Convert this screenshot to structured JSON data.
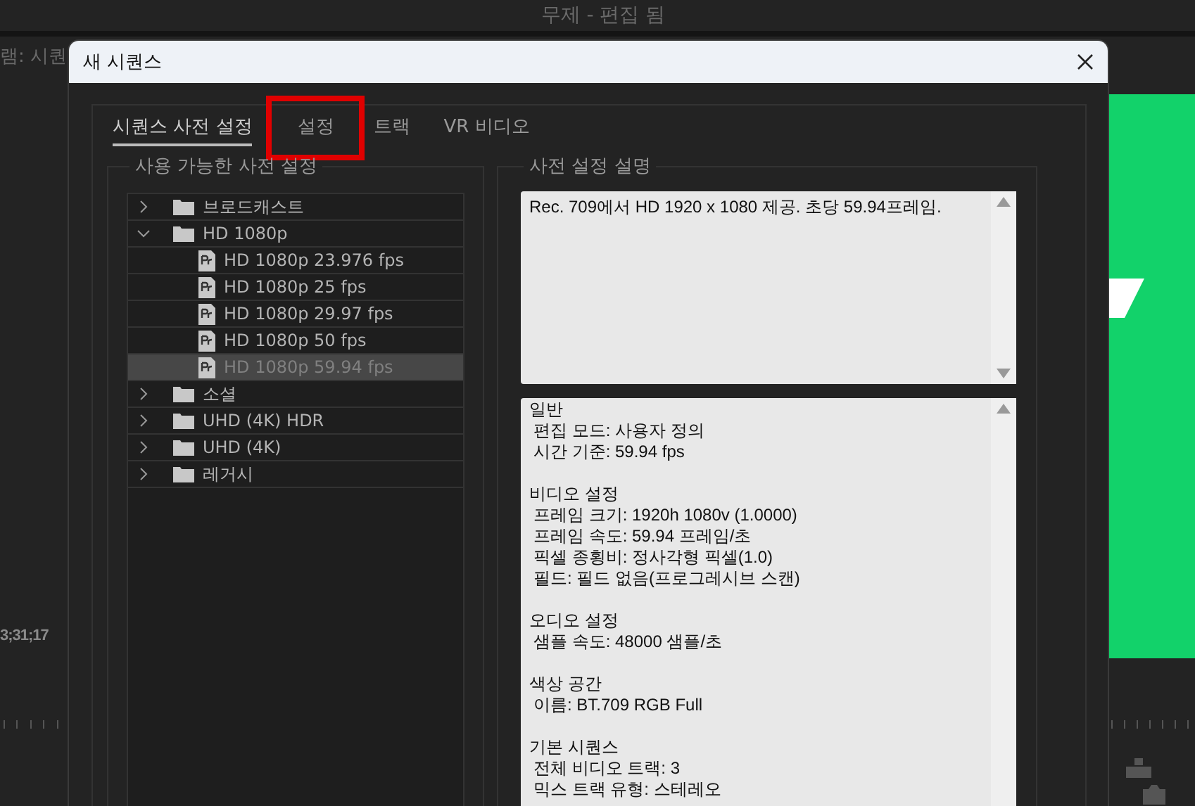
{
  "app": {
    "title": "무제 - 편집 됨",
    "left_panel_label": "램: 시퀀",
    "timecode": "3;31;17"
  },
  "dialog": {
    "title": "새 시퀀스",
    "tabs": [
      {
        "label": "시퀀스 사전 설정",
        "selected": true,
        "highlighted": false
      },
      {
        "label": "설정",
        "selected": false,
        "highlighted": true
      },
      {
        "label": "트랙",
        "selected": false,
        "highlighted": false
      },
      {
        "label": "VR 비디오",
        "selected": false,
        "highlighted": false
      }
    ],
    "presets": {
      "title": "사용 가능한 사전 설정",
      "items": [
        {
          "label": "브로드캐스트",
          "expanded": false,
          "selected": false
        },
        {
          "label": "HD 1080p",
          "expanded": true,
          "selected": false,
          "children": [
            {
              "label": "HD 1080p 23.976 fps",
              "selected": false
            },
            {
              "label": "HD 1080p 25 fps",
              "selected": false
            },
            {
              "label": "HD 1080p 29.97 fps",
              "selected": false
            },
            {
              "label": "HD 1080p 50 fps",
              "selected": false
            },
            {
              "label": "HD 1080p 59.94 fps",
              "selected": true
            }
          ]
        },
        {
          "label": "소셜",
          "expanded": false,
          "selected": false
        },
        {
          "label": "UHD (4K) HDR",
          "expanded": false,
          "selected": false
        },
        {
          "label": "UHD (4K)",
          "expanded": false,
          "selected": false
        },
        {
          "label": "레거시",
          "expanded": false,
          "selected": false
        }
      ]
    },
    "description": {
      "title": "사전 설정 설명",
      "text": "Rec. 709에서 HD 1920 x 1080 제공. 초당 59.94프레임.",
      "sections": [
        {
          "heading": "일반",
          "lines": [
            "편집 모드: 사용자 정의",
            "시간 기준: 59.94 fps"
          ]
        },
        {
          "heading": "비디오 설정",
          "lines": [
            "프레임 크기: 1920h 1080v (1.0000)",
            "프레임 속도: 59.94  프레임/초",
            "픽셀 종횡비: 정사각형 픽셀(1.0)",
            "필드: 필드 없음(프로그레시브 스캔)"
          ]
        },
        {
          "heading": "오디오 설정",
          "lines": [
            "샘플 속도: 48000 샘플/초"
          ]
        },
        {
          "heading": "색상 공간",
          "lines": [
            "이름: BT.709 RGB Full"
          ]
        },
        {
          "heading": "기본 시퀀스",
          "lines": [
            "전체 비디오 트랙: 3",
            "믹스 트랙 유형: 스테레오"
          ]
        }
      ]
    }
  }
}
